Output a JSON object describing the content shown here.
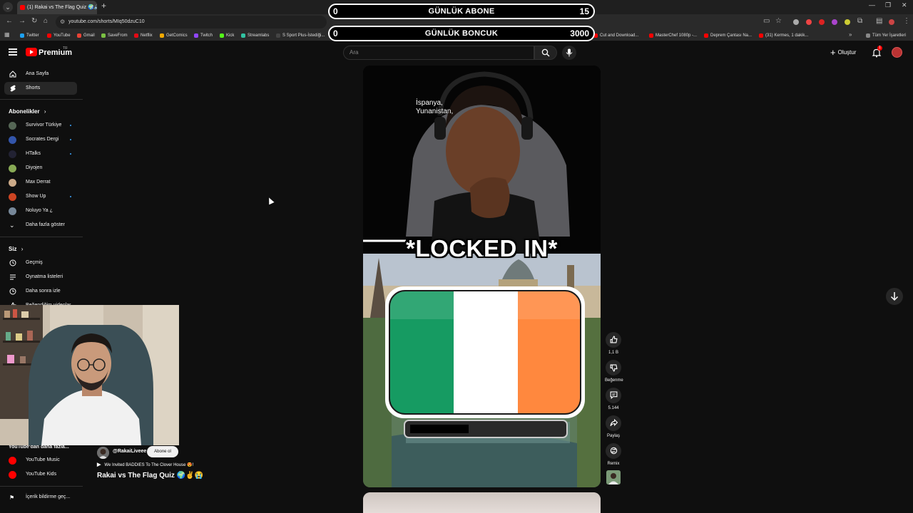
{
  "browser": {
    "tab_title": "(1) Rakai vs The Flag Quiz",
    "tab_icons": "🌍🔊",
    "url": "youtube.com/shorts/MIq50dzuC10",
    "bookmarks": [
      "Twitter",
      "YouTube",
      "Gmail",
      "SaveFrom",
      "Netflix",
      "GetComics",
      "Twitch",
      "Kick",
      "Streamlabs",
      "S Sport Plus-İstediği...",
      "Crunchyroll",
      "Cuttly",
      "NBA Games",
      "usTotal - Home",
      "GeoGuessr",
      "Cut and Download...",
      "MasterChef 1080p -...",
      "Deprem Çantası Na...",
      "(31) Kermes, 1 dakik..."
    ],
    "all_bookmarks": "Tüm Yer İşaretleri",
    "colors": {
      "bookmark_icons": [
        "#1da1f2",
        "#ff0000",
        "#ea4335",
        "#7ac143",
        "#e50914",
        "#f2a900",
        "#9146ff",
        "#53fc18",
        "#31c3a2",
        "#444444",
        "#f47521",
        "#2d6ae3",
        "#1d428a",
        "#394eff",
        "#d32f2f",
        "#ff0000",
        "#ff0000",
        "#ff0000",
        "#ff0000"
      ]
    }
  },
  "overlay": {
    "abone": {
      "left": "0",
      "label": "GÜNLÜK ABONE",
      "right": "15"
    },
    "boncuk": {
      "left": "0",
      "label": "GÜNLÜK BONCUK",
      "right": "3000"
    }
  },
  "header": {
    "brand": "Premium",
    "brand_suffix": "TR",
    "search_placeholder": "Ara",
    "create_label": "Oluştur",
    "notif_count": "1"
  },
  "sidebar": {
    "main": [
      {
        "label": "Ana Sayfa",
        "icon": "home-icon"
      },
      {
        "label": "Shorts",
        "icon": "shorts-icon",
        "active": true
      }
    ],
    "subs_title": "Abonelikler",
    "subscriptions": [
      {
        "label": "Survivor Türkiye",
        "color": "#556655",
        "dot": true
      },
      {
        "label": "Socrates Dergi",
        "color": "#3355aa",
        "dot": true
      },
      {
        "label": "HTalks",
        "color": "#222233",
        "dot": true
      },
      {
        "label": "Diyojen",
        "color": "#88aa55",
        "dot": false
      },
      {
        "label": "Max Derrat",
        "color": "#ccaa88",
        "dot": false
      },
      {
        "label": "Show Up",
        "color": "#cc4422",
        "dot": true
      },
      {
        "label": "Noluyo Ya ¿",
        "color": "#778899",
        "dot": false
      }
    ],
    "show_more": "Daha fazla göster",
    "you_title": "Siz",
    "you": [
      {
        "label": "Geçmiş",
        "icon": "history-icon"
      },
      {
        "label": "Oynatma listeleri",
        "icon": "playlist-icon"
      },
      {
        "label": "Daha sonra izle",
        "icon": "watch-later-icon"
      },
      {
        "label": "Beğendiğim videolar",
        "icon": "like-icon"
      }
    ],
    "more_from": "YouTube'dan daha fazla...",
    "apps": [
      {
        "label": "YouTube Music",
        "color": "#ff0000"
      },
      {
        "label": "YouTube Kids",
        "color": "#ff0000"
      }
    ],
    "footer": "İçerik bildirme geç..."
  },
  "short": {
    "overlay_text": [
      "İspanya,",
      "Yunanistan,"
    ],
    "caption": "*LOCKED IN*",
    "channel": "@RakaiLiveee",
    "subscribe": "Abone ol",
    "related": "We Invited BADDIES To The Clover House 😍!",
    "title": "Rakai vs The Flag Quiz 🌍✌️😭",
    "flag_colors": [
      "#169b62",
      "#ffffff",
      "#ff883e"
    ]
  },
  "actions": [
    {
      "name": "like",
      "label": "1,1 B",
      "icon": "thumbs-up-icon"
    },
    {
      "name": "dislike",
      "label": "Beğenme",
      "icon": "thumbs-down-icon"
    },
    {
      "name": "comments",
      "label": "5.144",
      "icon": "comment-icon"
    },
    {
      "name": "share",
      "label": "Paylaş",
      "icon": "share-icon"
    },
    {
      "name": "remix",
      "label": "Remix",
      "icon": "remix-icon"
    }
  ]
}
